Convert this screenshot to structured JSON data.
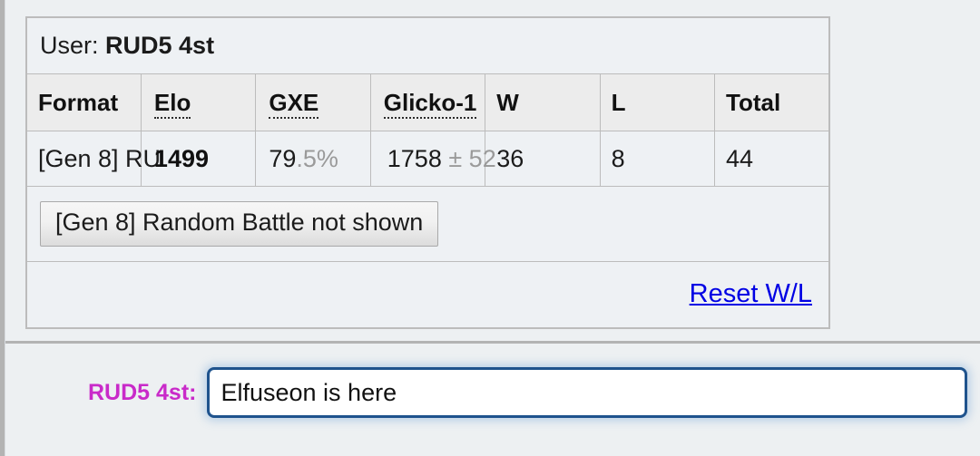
{
  "panel": {
    "user_label": "User:",
    "username": "RUD5 4st",
    "table": {
      "headers": [
        "Format",
        "Elo",
        "GXE",
        "Glicko-1",
        "W",
        "L",
        "Total"
      ],
      "rows": [
        {
          "format": "[Gen 8] RU",
          "elo": "1499",
          "gxe_main": "79",
          "gxe_dim": ".5%",
          "glicko_main": "1758",
          "glicko_dim": "± 52",
          "w": "36",
          "l": "8",
          "total": "44"
        }
      ]
    },
    "hidden_format_button": "[Gen 8] Random Battle not shown",
    "reset_link": "Reset W/L"
  },
  "chat": {
    "username_label": "RUD5 4st:",
    "input_value": "Elfuseon is here",
    "input_placeholder": ""
  },
  "colors": {
    "link": "#0000e4",
    "username_accent": "#c92ac9",
    "focus_border": "#1f538d",
    "panel_bg": "#edf0f2",
    "header_bg": "#ececec",
    "row_bg": "#eef1f4",
    "border": "#bcbcbc",
    "dim_text": "#9a9a9a"
  }
}
